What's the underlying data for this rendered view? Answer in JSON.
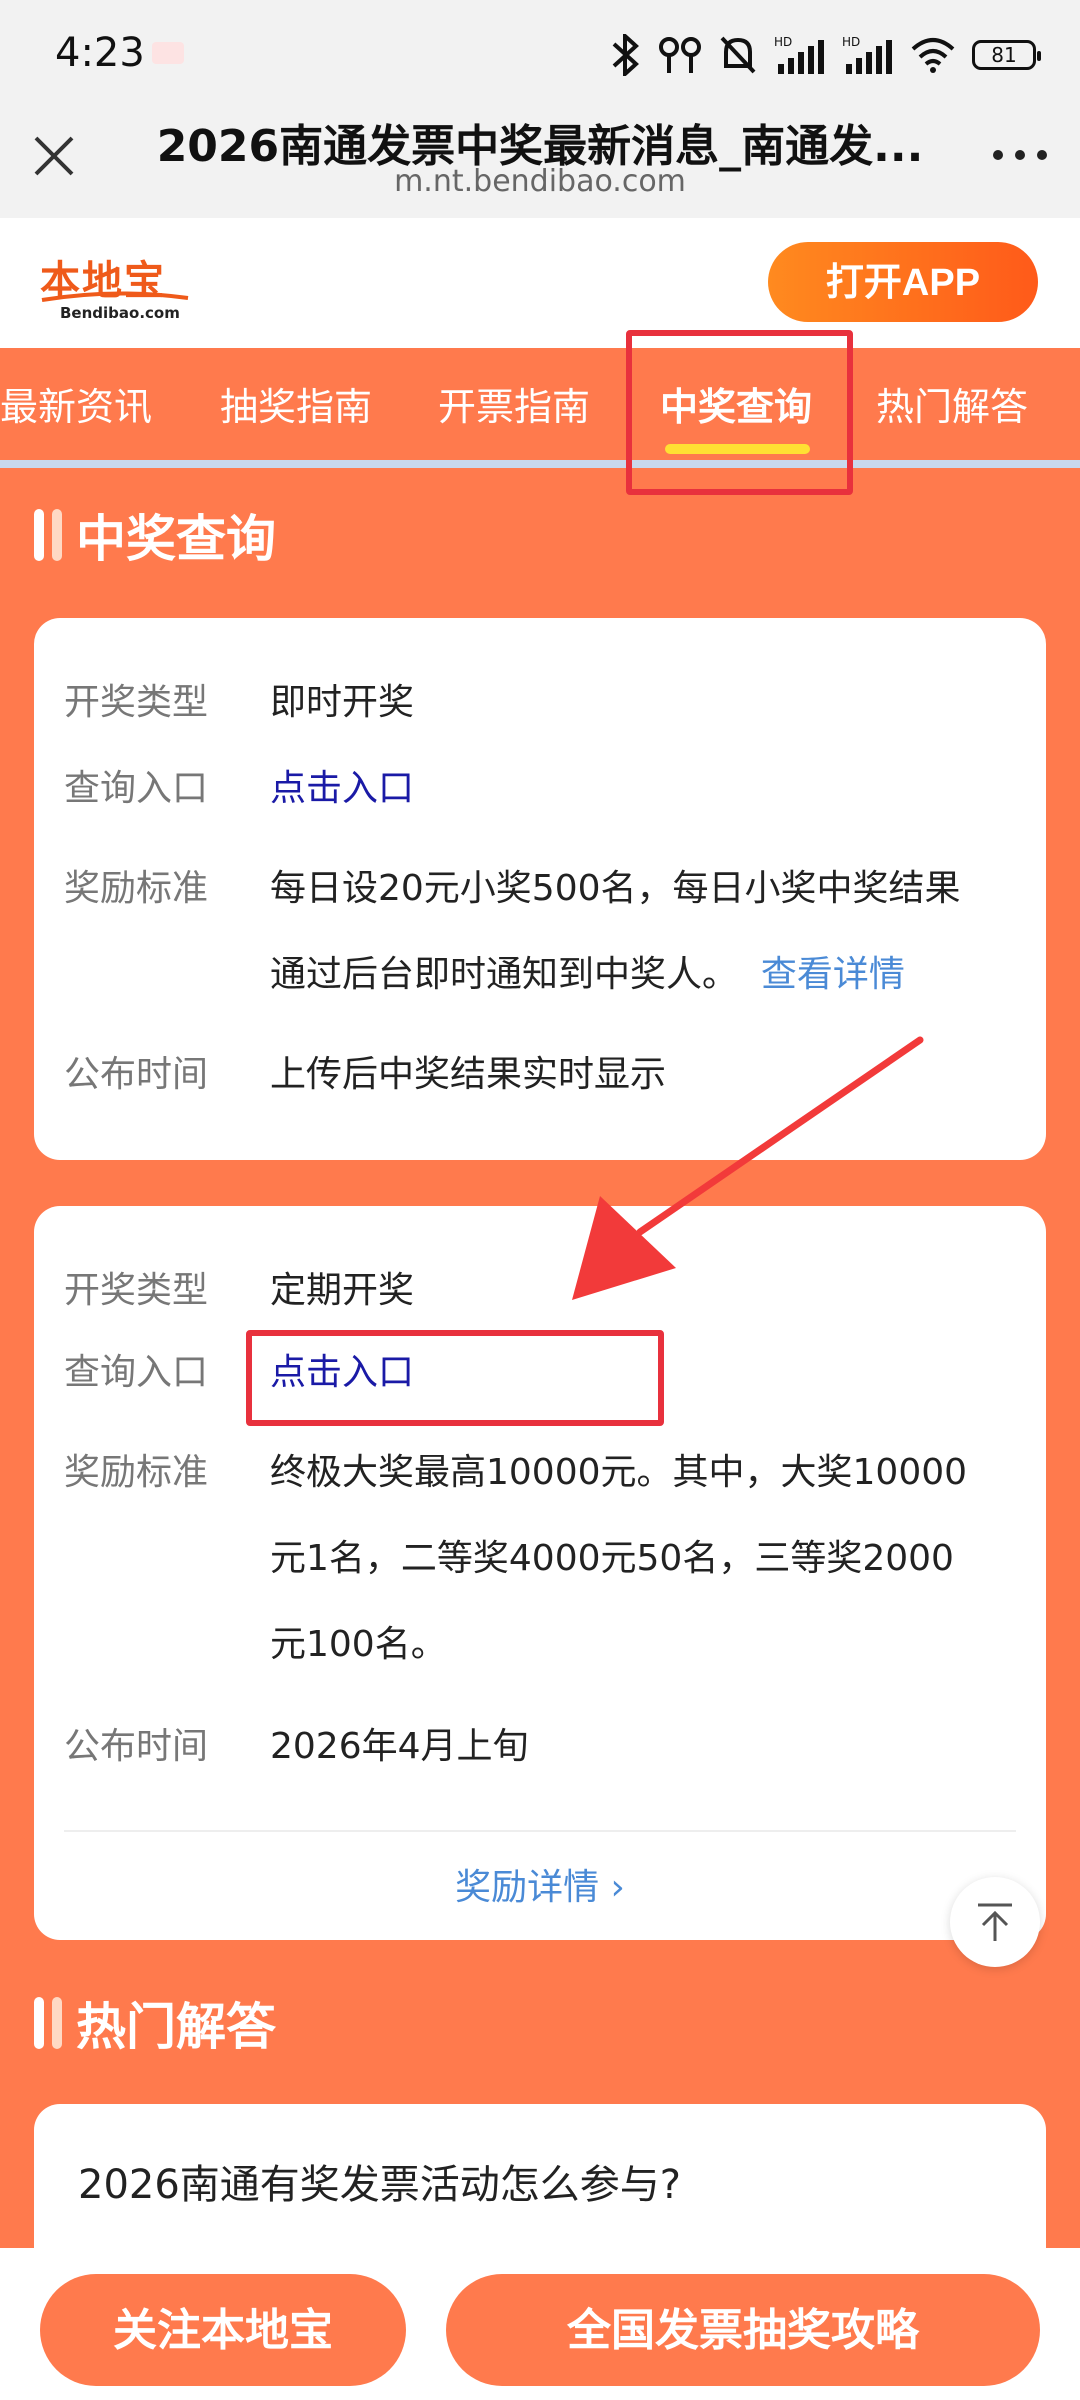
{
  "status": {
    "time": "4:23",
    "battery": "81"
  },
  "browser": {
    "title": "2026南通发票中奖最新消息_南通发...",
    "url": "m.nt.bendibao.com"
  },
  "header": {
    "logo_text": "本地宝",
    "logo_sub": "Bendibao.com",
    "open_app": "打开APP"
  },
  "nav": {
    "tabs": [
      "最新资讯",
      "抽奖指南",
      "开票指南",
      "中奖查询",
      "热门解答"
    ],
    "active": "中奖查询"
  },
  "section_query": {
    "title": "中奖查询",
    "cards": [
      {
        "type_label": "开奖类型",
        "type_value": "即时开奖",
        "entry_label": "查询入口",
        "entry_value": "点击入口",
        "reward_label": "奖励标准",
        "reward_line1": "每日设20元小奖500名，每日小奖中奖结果",
        "reward_line2": "通过后台即时通知到中奖人。",
        "reward_more": "查看详情",
        "time_label": "公布时间",
        "time_value": "上传后中奖结果实时显示"
      },
      {
        "type_label": "开奖类型",
        "type_value": "定期开奖",
        "entry_label": "查询入口",
        "entry_value": "点击入口",
        "reward_label": "奖励标准",
        "reward_line1": "终极大奖最高10000元。其中，大奖10000",
        "reward_line2": "元1名，二等奖4000元50名，三等奖2000",
        "reward_line3": "元100名。",
        "time_label": "公布时间",
        "time_value": "2026年4月上旬",
        "reward_detail": "奖励详情 ›"
      }
    ]
  },
  "section_hot": {
    "title": "热门解答",
    "question": "2026南通有奖发票活动怎么参与?"
  },
  "bottom": {
    "follow": "关注本地宝",
    "guide": "全国发票抽奖攻略"
  },
  "colors": {
    "accent": "#ff7a4d",
    "annotation": "#e8313d",
    "link": "#1a1aa6"
  }
}
